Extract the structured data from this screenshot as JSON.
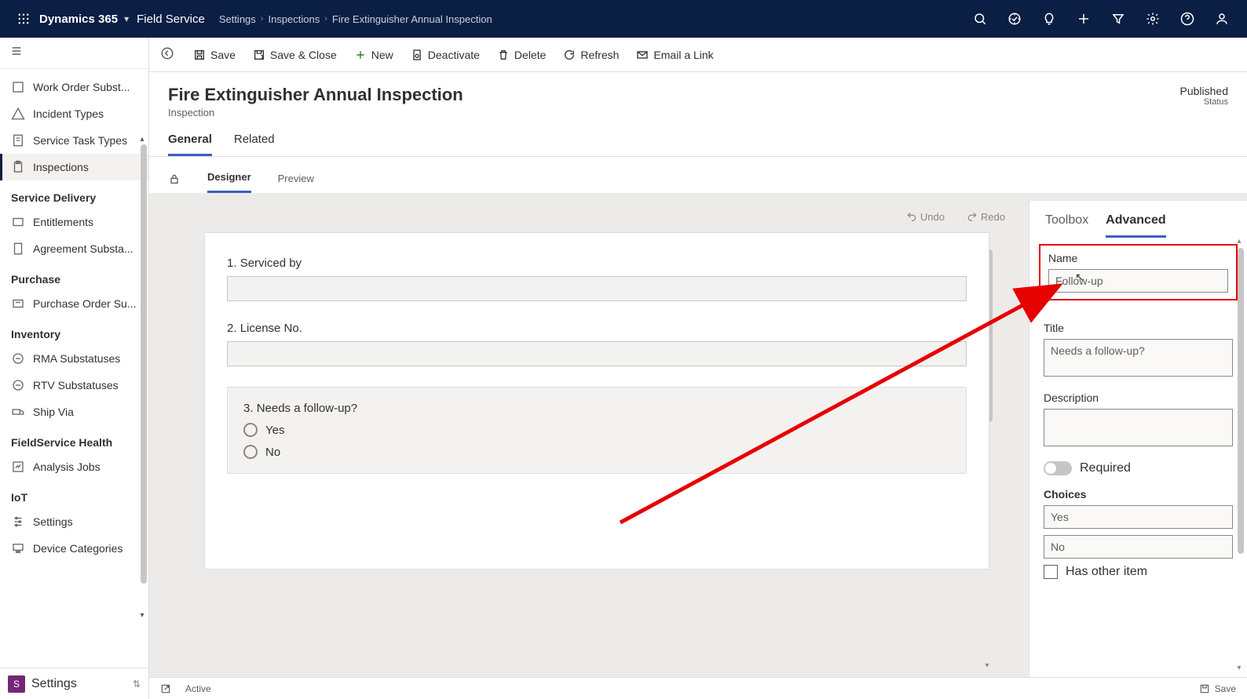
{
  "topnav": {
    "brand": "Dynamics 365",
    "module": "Field Service",
    "crumbs": [
      "Settings",
      "Inspections",
      "Fire Extinguisher Annual Inspection"
    ]
  },
  "sidebar": {
    "items_top": [
      {
        "label": "Work Order Subst...",
        "active": false,
        "icon": "box"
      },
      {
        "label": "Incident Types",
        "active": false,
        "icon": "warn"
      },
      {
        "label": "Service Task Types",
        "active": false,
        "icon": "task"
      },
      {
        "label": "Inspections",
        "active": true,
        "icon": "clip"
      }
    ],
    "sections": [
      {
        "title": "Service Delivery",
        "items": [
          {
            "label": "Entitlements",
            "icon": "tag"
          },
          {
            "label": "Agreement Substa...",
            "icon": "doc"
          }
        ]
      },
      {
        "title": "Purchase",
        "items": [
          {
            "label": "Purchase Order Su...",
            "icon": "cart"
          }
        ]
      },
      {
        "title": "Inventory",
        "items": [
          {
            "label": "RMA Substatuses",
            "icon": "swap"
          },
          {
            "label": "RTV Substatuses",
            "icon": "swap"
          },
          {
            "label": "Ship Via",
            "icon": "truck"
          }
        ]
      },
      {
        "title": "FieldService Health",
        "items": [
          {
            "label": "Analysis Jobs",
            "icon": "pulse"
          }
        ]
      },
      {
        "title": "IoT",
        "items": [
          {
            "label": "Settings",
            "icon": "sliders"
          },
          {
            "label": "Device Categories",
            "icon": "devices"
          }
        ]
      }
    ],
    "footer": {
      "badge": "S",
      "label": "Settings"
    }
  },
  "commands": {
    "save": "Save",
    "saveclose": "Save & Close",
    "new": "New",
    "deactivate": "Deactivate",
    "delete": "Delete",
    "refresh": "Refresh",
    "email": "Email a Link"
  },
  "page": {
    "title": "Fire Extinguisher Annual Inspection",
    "subtitle": "Inspection",
    "status_value": "Published",
    "status_label": "Status"
  },
  "tabs": {
    "general": "General",
    "related": "Related"
  },
  "subtabs": {
    "designer": "Designer",
    "preview": "Preview"
  },
  "canvas": {
    "undo": "Undo",
    "redo": "Redo",
    "q1": {
      "num": "1.",
      "label": "Serviced by"
    },
    "q2": {
      "num": "2.",
      "label": "License No."
    },
    "q3": {
      "num": "3.",
      "label": "Needs a follow-up?",
      "opt1": "Yes",
      "opt2": "No"
    }
  },
  "rightpanel": {
    "tab_toolbox": "Toolbox",
    "tab_advanced": "Advanced",
    "name_label": "Name",
    "name_value": "Follow-up",
    "title_label": "Title",
    "title_value": "Needs a follow-up?",
    "desc_label": "Description",
    "desc_value": "",
    "required_label": "Required",
    "choices_label": "Choices",
    "choice1": "Yes",
    "choice2": "No",
    "hasother_label": "Has other item"
  },
  "statusbar": {
    "active": "Active",
    "save": "Save"
  }
}
